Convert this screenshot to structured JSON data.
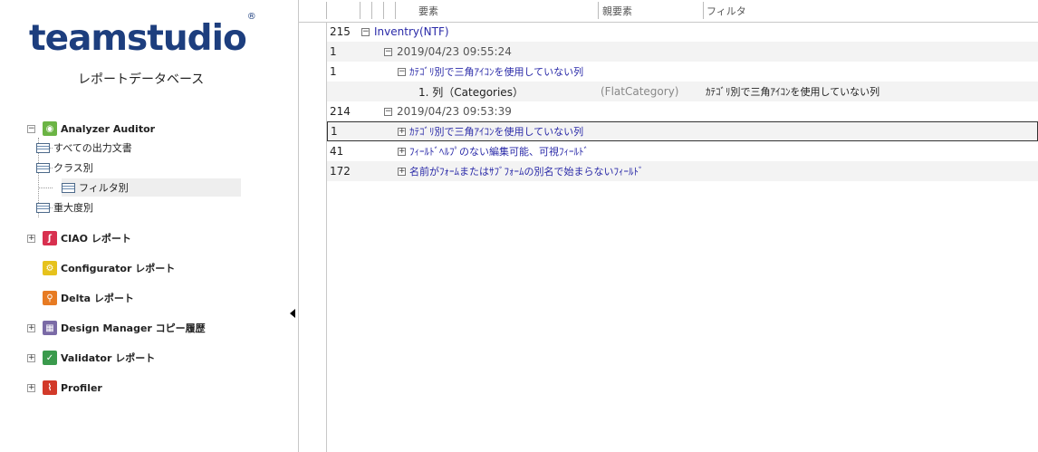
{
  "app": {
    "logo_text": "teamstudio",
    "logo_mark": "®",
    "subtitle": "レポートデータベース"
  },
  "sidebar": {
    "analyzer": "Analyzer Auditor",
    "analyzer_items": [
      "すべての出力文書",
      "クラス別",
      "フィルタ別",
      "重大度別"
    ],
    "selected_item": "フィルタ別",
    "ciao": "CIAO レポート",
    "configurator": "Configurator レポート",
    "delta": "Delta レポート",
    "dm": "Design Manager コピー履歴",
    "validator": "Validator レポート",
    "profiler": "Profiler"
  },
  "columns": {
    "element": "要素",
    "parent": "親要素",
    "filter": "フィルタ"
  },
  "rows": [
    {
      "count": "215",
      "text": "Inventry(NTF)"
    },
    {
      "count": "1",
      "text": "2019/04/23 09:55:24"
    },
    {
      "count": "1",
      "text": "ｶﾃｺﾞﾘ別で三角ｱｲｺﾝを使用していない列"
    },
    {
      "count": "",
      "text": "1. 列（Categories）",
      "parent": "(FlatCategory)",
      "filter": "ｶﾃｺﾞﾘ別で三角ｱｲｺﾝを使用していない列"
    },
    {
      "count": "214",
      "text": "2019/04/23 09:53:39"
    },
    {
      "count": "1",
      "text": "ｶﾃｺﾞﾘ別で三角ｱｲｺﾝを使用していない列"
    },
    {
      "count": "41",
      "text": "ﾌｨｰﾙﾄﾞﾍﾙﾌﾟのない編集可能、可視ﾌｨｰﾙﾄﾞ"
    },
    {
      "count": "172",
      "text": "名前がﾌｫｰﾑまたはｻﾌﾞﾌｫｰﾑの別名で始まらないﾌｨｰﾙﾄﾞ"
    }
  ],
  "colors": {
    "brand": "#1d3e7e",
    "link": "#2a2aa8"
  }
}
